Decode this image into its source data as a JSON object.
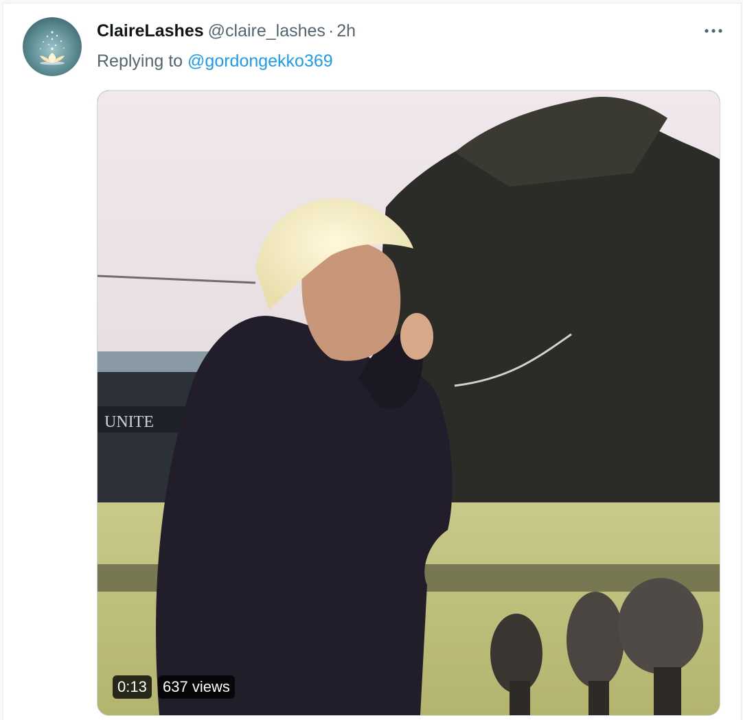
{
  "tweet": {
    "display_name": "ClaireLashes",
    "handle": "@claire_lashes",
    "separator": "·",
    "time": "2h",
    "replying_label": "Replying to",
    "replying_to": "@gordongekko369",
    "more_icon": "more-horizontal-icon"
  },
  "media": {
    "type": "video",
    "duration": "0:13",
    "views": "637 views"
  },
  "colors": {
    "link": "#1d9bf0",
    "secondary_text": "#536471",
    "primary_text": "#0f1419"
  }
}
